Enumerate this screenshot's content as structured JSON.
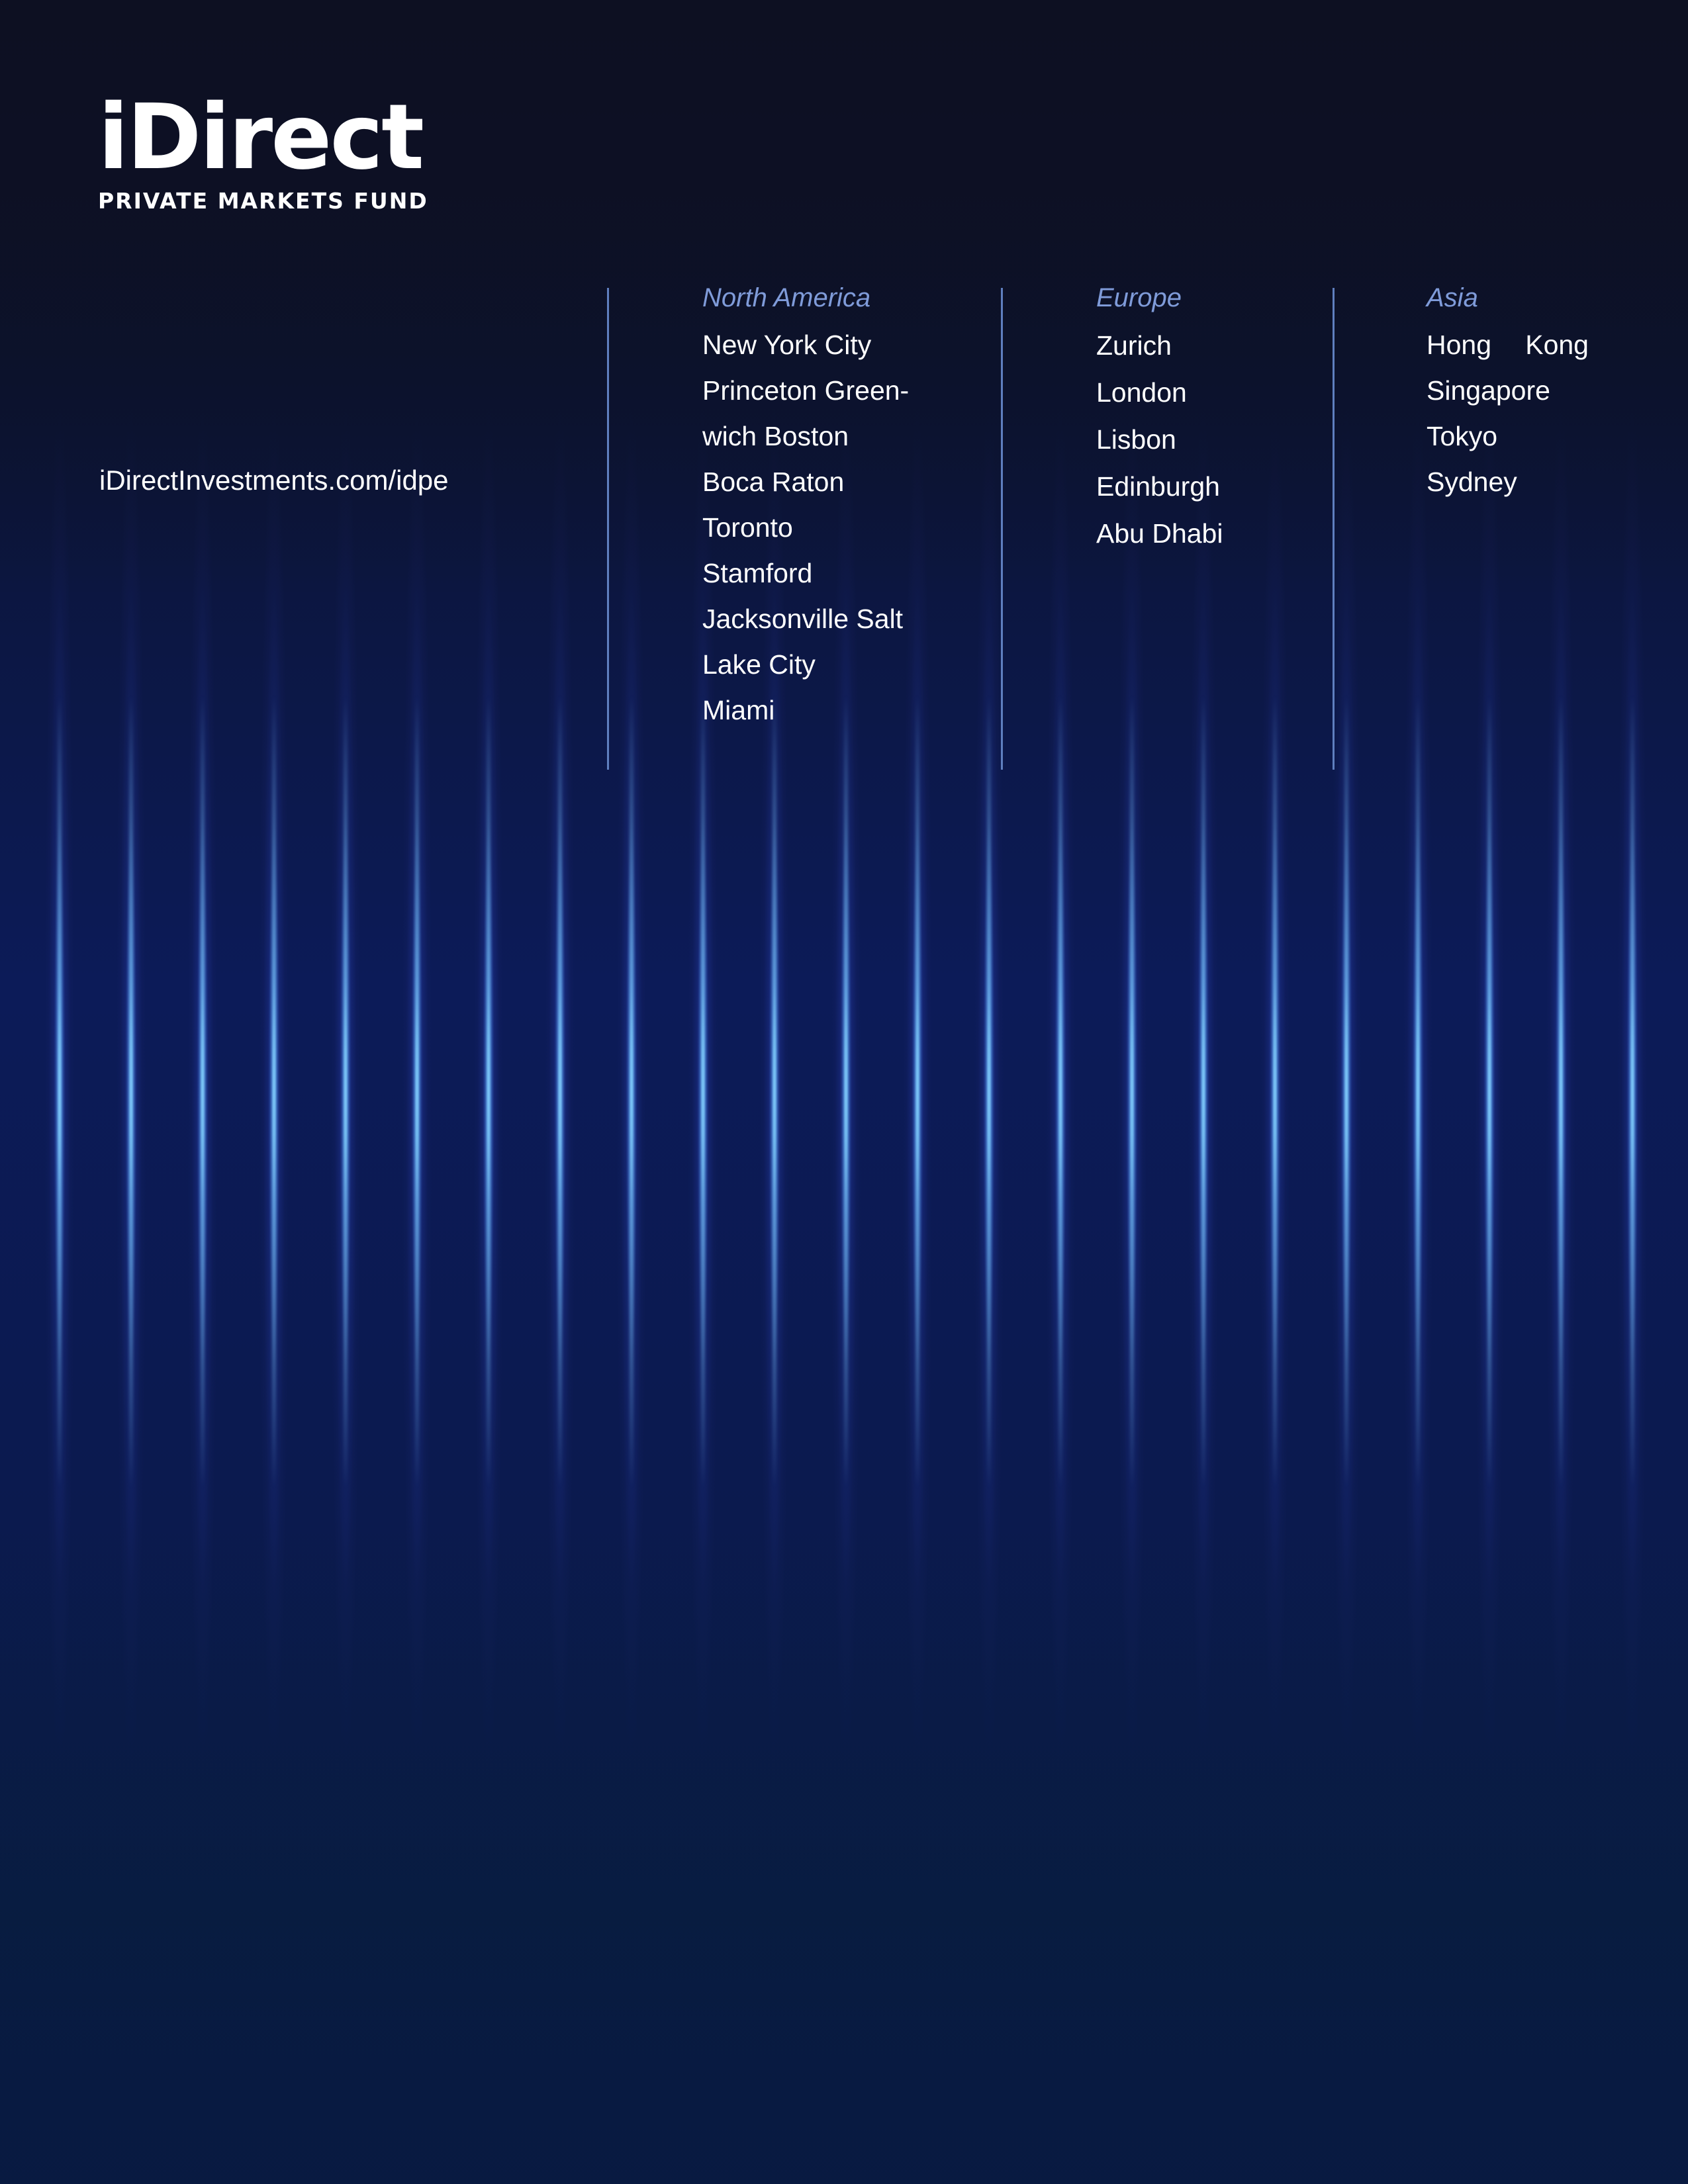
{
  "brand": {
    "logo_word": "iDirect",
    "logo_subtitle": "PRIVATE MARKETS FUND"
  },
  "website": "iDirectInvestments.com/idpe",
  "regions": [
    {
      "heading": "North America",
      "cities": [
        "New York City",
        "Princeton Green-",
        "wich Boston",
        "Boca Raton",
        "Toronto",
        "Stamford",
        "Jacksonville Salt",
        "Lake City",
        "Miami"
      ]
    },
    {
      "heading": "Europe",
      "cities": [
        "Zurich",
        "London",
        "Lisbon",
        "Edinburgh",
        "Abu Dhabi"
      ]
    },
    {
      "heading": "Asia",
      "cities": [
        "Hong",
        "Kong",
        "Singapore",
        "Tokyo",
        "Sydney"
      ]
    }
  ],
  "colors": {
    "background": "#0b1236",
    "heading": "#7f9bd9",
    "divider": "#5f7fbf",
    "text": "#ffffff"
  }
}
